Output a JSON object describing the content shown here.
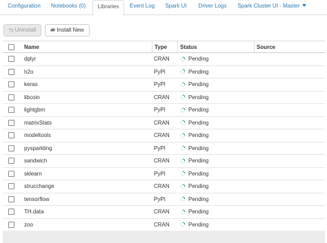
{
  "tabs": [
    {
      "label": "Configuration"
    },
    {
      "label": "Notebooks (0)"
    },
    {
      "label": "Libraries"
    },
    {
      "label": "Event Log"
    },
    {
      "label": "Spark UI"
    },
    {
      "label": "Driver Logs"
    },
    {
      "label": "Spark Cluster UI - Master"
    }
  ],
  "active_tab": "Libraries",
  "toolbar": {
    "uninstall_label": "Uninstall",
    "install_new_label": "Install New"
  },
  "table": {
    "headers": {
      "name": "Name",
      "type": "Type",
      "status": "Status",
      "source": "Source"
    },
    "rows": [
      {
        "name": "dplyr",
        "type": "CRAN",
        "status": "Pending",
        "source": ""
      },
      {
        "name": "h2o",
        "type": "PyPI",
        "status": "Pending",
        "source": ""
      },
      {
        "name": "keras",
        "type": "PyPI",
        "status": "Pending",
        "source": ""
      },
      {
        "name": "libcoin",
        "type": "CRAN",
        "status": "Pending",
        "source": ""
      },
      {
        "name": "lightgbm",
        "type": "PyPI",
        "status": "Pending",
        "source": ""
      },
      {
        "name": "matrixStats",
        "type": "CRAN",
        "status": "Pending",
        "source": ""
      },
      {
        "name": "modeltools",
        "type": "CRAN",
        "status": "Pending",
        "source": ""
      },
      {
        "name": "pysparkling",
        "type": "PyPI",
        "status": "Pending",
        "source": ""
      },
      {
        "name": "sandwich",
        "type": "CRAN",
        "status": "Pending",
        "source": ""
      },
      {
        "name": "sklearn",
        "type": "PyPI",
        "status": "Pending",
        "source": ""
      },
      {
        "name": "strucchange",
        "type": "CRAN",
        "status": "Pending",
        "source": ""
      },
      {
        "name": "tensorflow",
        "type": "PyPI",
        "status": "Pending",
        "source": ""
      },
      {
        "name": "TH.data",
        "type": "CRAN",
        "status": "Pending",
        "source": ""
      },
      {
        "name": "zoo",
        "type": "CRAN",
        "status": "Pending",
        "source": ""
      }
    ]
  },
  "colors": {
    "link": "#2a7ab0",
    "spinner": "#3cb371"
  }
}
